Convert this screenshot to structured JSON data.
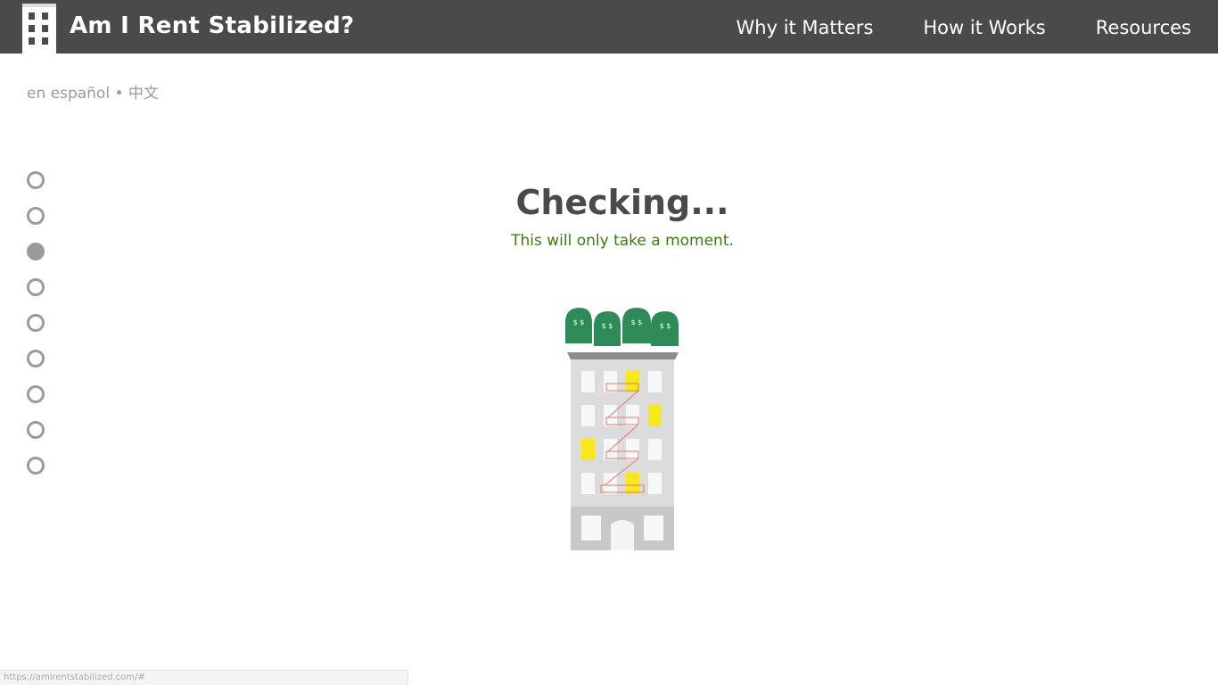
{
  "header": {
    "brand": "Am I Rent Stabilized?",
    "logo_icon": "building-icon",
    "nav": [
      "Why it Matters",
      "How it Works",
      "Resources"
    ]
  },
  "languages": {
    "spanish": "en español",
    "separator": "•",
    "chinese": "中文"
  },
  "progress": {
    "total_steps": 9,
    "current_step": 3
  },
  "main": {
    "title": "Checking...",
    "subtitle": "This will only take a moment."
  },
  "illustration": {
    "name": "building-illustration",
    "cloud_label": "$ $"
  },
  "status_bar": {
    "url": "https://amirentstabilized.com/#"
  },
  "colors": {
    "nav_bg": "#4a4a4a",
    "subtitle": "#3a7a10",
    "money_green": "#2e8b57",
    "window_lit": "#f8e71c",
    "dot": "#9b9b9b"
  }
}
